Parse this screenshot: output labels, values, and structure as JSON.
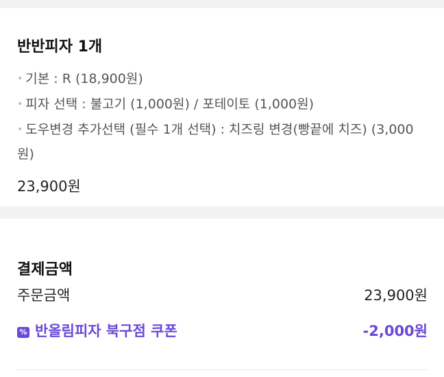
{
  "item": {
    "title": "반반피자 1개",
    "options": [
      "기본 : R (18,900원)",
      "피자 선택 : 불고기 (1,000원) / 포테이토 (1,000원)",
      "도우변경 추가선택 (필수 1개 선택) : 치즈링 변경(빵끝에 치즈) (3,000원)"
    ],
    "price": "23,900원"
  },
  "payment": {
    "title": "결제금액",
    "order_label": "주문금액",
    "order_value": "23,900원",
    "coupon_label": "반올림피자 북구점 쿠폰",
    "coupon_value": "-2,000원",
    "coupon_icon": "percent-coupon-icon",
    "accent_color": "#6a48d9"
  }
}
